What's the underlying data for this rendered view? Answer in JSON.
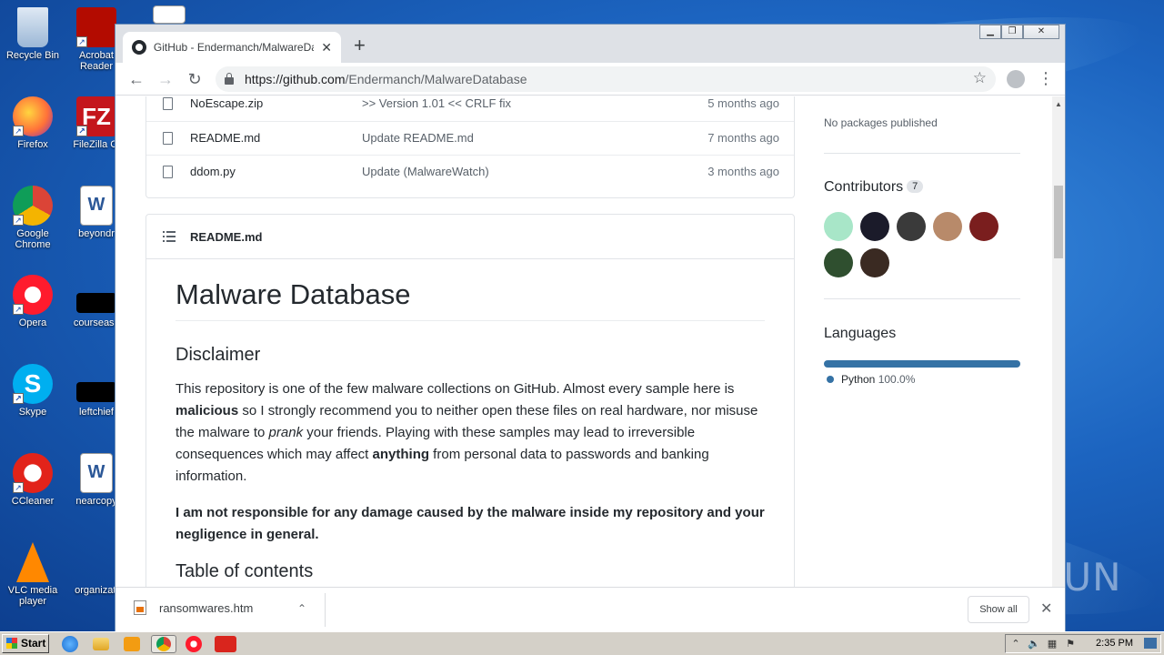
{
  "desktop": {
    "icons": [
      {
        "label": "Recycle Bin",
        "color": "#9bb7d6"
      },
      {
        "label": "Acrobat Reader",
        "color": "#b30b00"
      },
      {
        "label": "Firefox",
        "color": "#ff7139"
      },
      {
        "label": "FileZilla Cl",
        "color": "#c4161c"
      },
      {
        "label": "Google Chrome",
        "color": "#4285f4"
      },
      {
        "label": "beyondr",
        "color": "#2b5797"
      },
      {
        "label": "Opera",
        "color": "#ff1b2d"
      },
      {
        "label": "courseass",
        "color": "#000000"
      },
      {
        "label": "Skype",
        "color": "#00aff0"
      },
      {
        "label": "leftchief",
        "color": "#000000"
      },
      {
        "label": "CCleaner",
        "color": "#e2231a"
      },
      {
        "label": "nearcopy",
        "color": "#2b5797"
      },
      {
        "label": "VLC media player",
        "color": "#ff8800"
      },
      {
        "label": "organizati",
        "color": "#1a4f9e"
      }
    ]
  },
  "browser": {
    "tab_title": "GitHub - Endermanch/MalwareDatab",
    "url_host": "https://github.com",
    "url_path": "/Endermanch/MalwareDatabase",
    "icons": {
      "back": "back-arrow-icon",
      "forward": "forward-arrow-icon",
      "reload": "reload-icon",
      "star": "star-icon",
      "menu": "kebab-menu-icon"
    }
  },
  "files": [
    {
      "name": "NoEscape.zip",
      "message": ">> Version 1.01 << CRLF fix",
      "age": "5 months ago"
    },
    {
      "name": "README.md",
      "message": "Update README.md",
      "age": "7 months ago"
    },
    {
      "name": "ddom.py",
      "message": "Update (MalwareWatch)",
      "age": "3 months ago"
    }
  ],
  "readme": {
    "header": "README.md",
    "h1": "Malware Database",
    "h2_disclaimer": "Disclaimer",
    "p1_a": "This repository is one of the few malware collections on GitHub. Almost every sample here is ",
    "p1_b": "malicious",
    "p1_c": " so I strongly recommend you to neither open these files on real hardware, nor misuse the malware to ",
    "p1_d": "prank",
    "p1_e": " your friends. Playing with these samples may lead to irreversible consequences which may affect ",
    "p1_f": "anything",
    "p1_g": " from personal data to passwords and banking information.",
    "p2": "I am not responsible for any damage caused by the malware inside my repository and your negligence in general.",
    "h2_toc": "Table of contents"
  },
  "sidebar": {
    "packages_text": "No packages published",
    "contributors_title": "Contributors",
    "contributors_count": "7",
    "contributor_colors": [
      "#a8e6c8",
      "#1b1b2a",
      "#3a3a3a",
      "#b88a6a",
      "#7a1e1e",
      "#2f4f2f",
      "#3a2a22"
    ],
    "languages_title": "Languages",
    "language_name": "Python",
    "language_pct": "100.0%",
    "language_share": 1.0,
    "language_color": "#3572a5"
  },
  "download": {
    "filename": "ransomwares.htm",
    "show_all": "Show all"
  },
  "watermark": "ANY RUN",
  "taskbar": {
    "start": "Start",
    "clock": "2:35 PM"
  }
}
